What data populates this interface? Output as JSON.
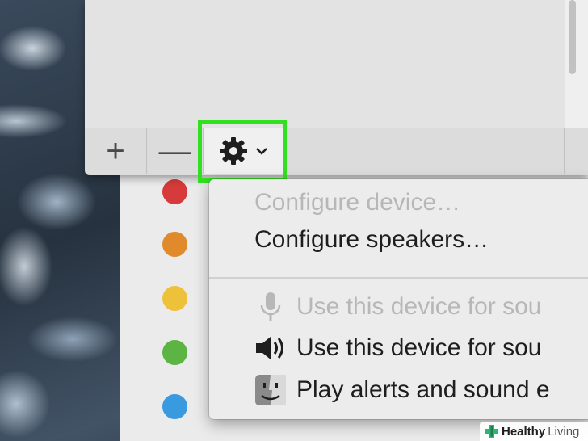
{
  "toolbar": {
    "add_label": "+",
    "remove_label": "—",
    "gear_icon": "gear-icon",
    "chevron_icon": "chevron-down-icon"
  },
  "menu": {
    "items": [
      {
        "label": "Configure device…",
        "enabled": false
      },
      {
        "label": "Configure speakers…",
        "enabled": true
      },
      {
        "label": "Use this device for sou",
        "enabled": false,
        "icon": "microphone-icon"
      },
      {
        "label": "Use this device for sou",
        "enabled": true,
        "icon": "speaker-icon"
      },
      {
        "label": "Play alerts and sound e",
        "enabled": true,
        "icon": "finder-icon"
      }
    ]
  },
  "colors": {
    "highlight": "#33e020",
    "device_dots": [
      "#d63a3a",
      "#e08a2c",
      "#eec13a",
      "#5cb542",
      "#3a9ae0"
    ]
  },
  "watermark": {
    "brand": "Healthy",
    "brand_suffix": "Living"
  }
}
